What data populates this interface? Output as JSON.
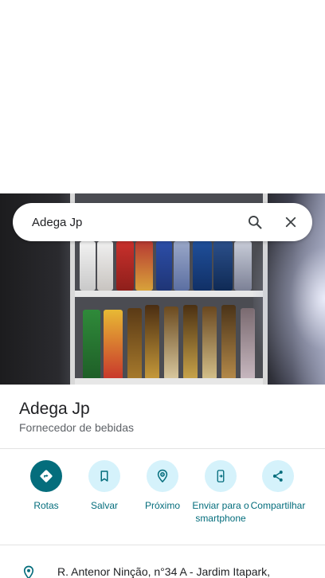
{
  "search": {
    "query": "Adega Jp",
    "icons": {
      "search": "search-icon",
      "close": "close-icon"
    }
  },
  "place": {
    "name": "Adega Jp",
    "category": "Fornecedor de bebidas"
  },
  "actions": [
    {
      "label": "Rotas",
      "icon": "directions-icon",
      "primary": true
    },
    {
      "label": "Salvar",
      "icon": "bookmark-icon",
      "primary": false
    },
    {
      "label": "Próximo",
      "icon": "nearby-icon",
      "primary": false
    },
    {
      "label": "Enviar para o smartphone",
      "icon": "send-to-phone-icon",
      "primary": false
    },
    {
      "label": "Compartilhar",
      "icon": "share-icon",
      "primary": false
    }
  ],
  "address": {
    "text": "R. Antenor Ninção, n°34 A - Jardim Itapark,",
    "icon": "location-pin-icon"
  },
  "colors": {
    "accent": "#046d7c",
    "action_bg": "#d5f2fb",
    "text_primary": "#202124",
    "text_secondary": "#5f6368"
  }
}
